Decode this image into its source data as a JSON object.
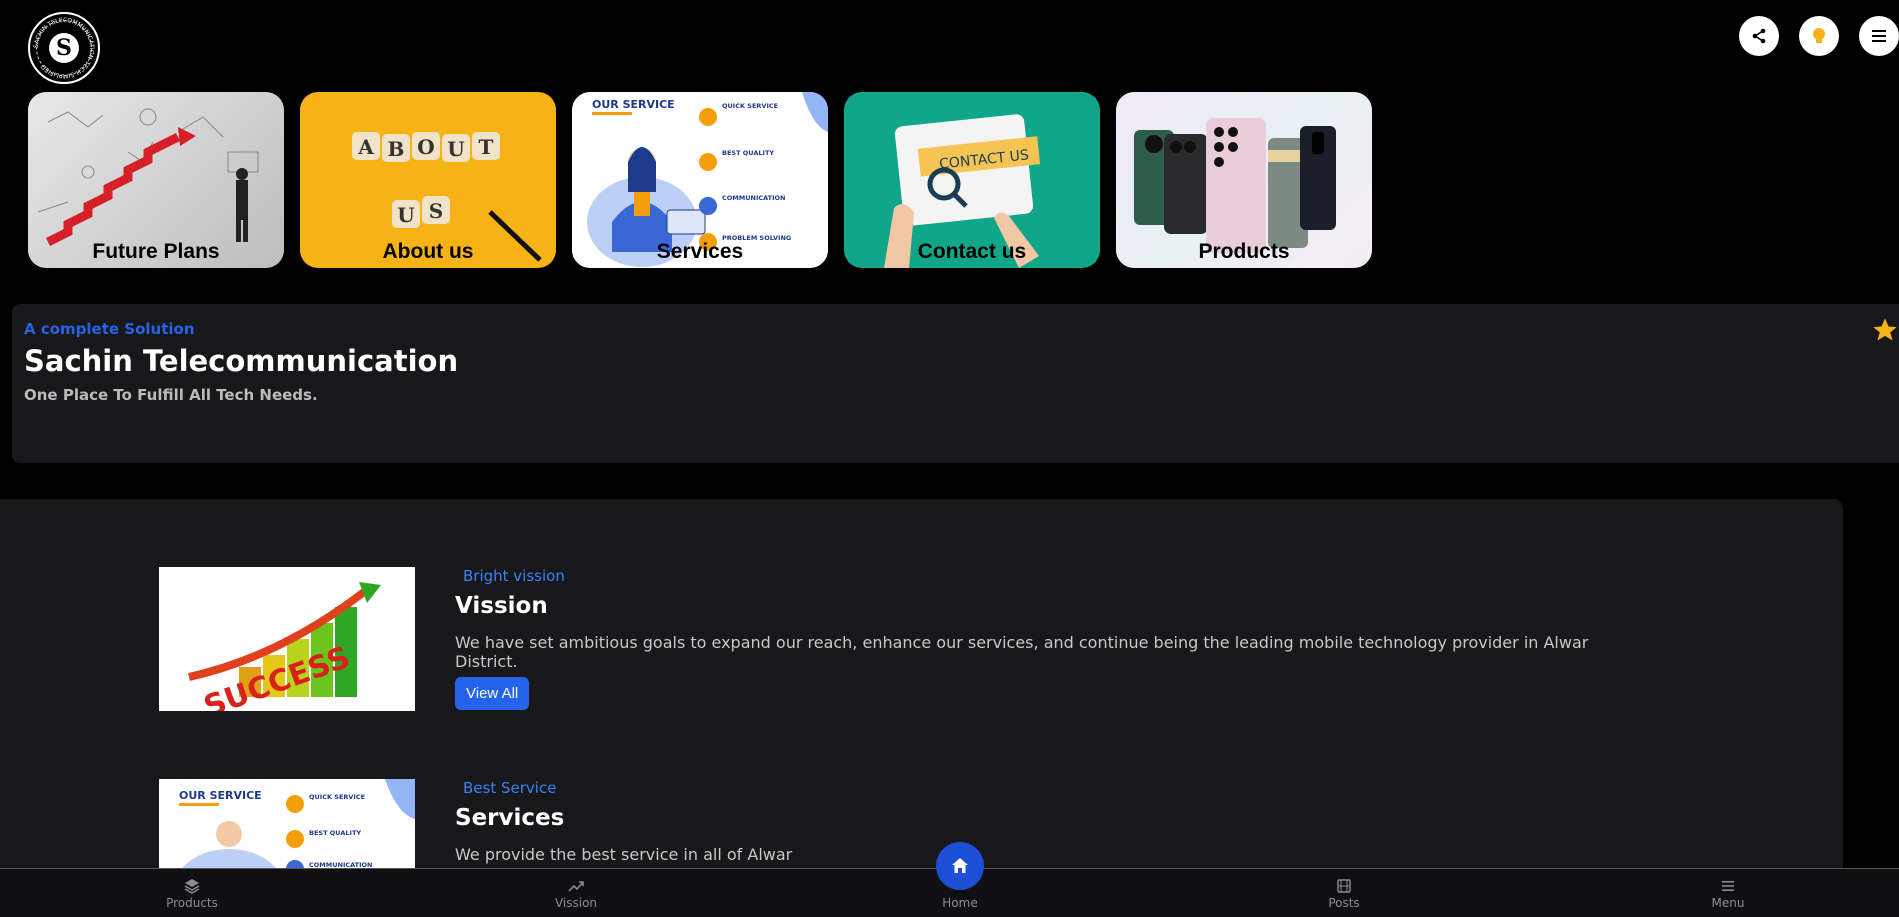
{
  "header": {
    "logo_icon": "sachin-telecommunication-logo",
    "logo_text": "SACHIN TELECOMMUNICATION TECH SIMPLIFIED",
    "actions": [
      {
        "icon": "share-icon"
      },
      {
        "icon": "lightbulb-icon"
      },
      {
        "icon": "menu-icon"
      }
    ]
  },
  "cards": [
    {
      "label": "Future Plans"
    },
    {
      "label": "About us",
      "image_text": [
        "A",
        "B",
        "O",
        "U",
        "T",
        "U",
        "S"
      ]
    },
    {
      "label": "Services",
      "image_text": {
        "title": "OUR SERVICE",
        "items": [
          "QUICK SERVICE",
          "BEST QUALITY",
          "COMMUNICATION",
          "PROBLEM SOLVING"
        ]
      }
    },
    {
      "label": "Contact us",
      "image_text": "CONTACT US"
    },
    {
      "label": "Products"
    }
  ],
  "hero": {
    "eyebrow": "A complete Solution",
    "title": "Sachin Telecommunication",
    "tagline": "One Place To Fulfill All Tech Needs.",
    "star_icon": "star-icon",
    "star_color": "#f6b21a"
  },
  "features": [
    {
      "eyebrow": "Bright vission",
      "title": "Vission",
      "description": "We have set ambitious goals to expand our reach, enhance our services, and continue being the leading mobile technology provider in Alwar District.",
      "button": "View All",
      "image_text": "SUCCESS"
    },
    {
      "eyebrow": "Best Service",
      "title": "Services",
      "description": "We provide the best service in all of Alwar",
      "image_text": {
        "title": "OUR SERVICE",
        "items": [
          "QUICK SERVICE",
          "BEST QUALITY",
          "COMMUNICATION"
        ]
      }
    }
  ],
  "bottom_nav": [
    {
      "label": "Products",
      "icon": "layers-icon"
    },
    {
      "label": "Vission",
      "icon": "trending-up-icon"
    },
    {
      "label": "Home",
      "icon": "home-icon"
    },
    {
      "label": "Posts",
      "icon": "film-icon"
    },
    {
      "label": "Menu",
      "icon": "menu-icon"
    }
  ],
  "colors": {
    "accent": "#2563eb",
    "panel": "#18181b",
    "background": "#000000"
  }
}
